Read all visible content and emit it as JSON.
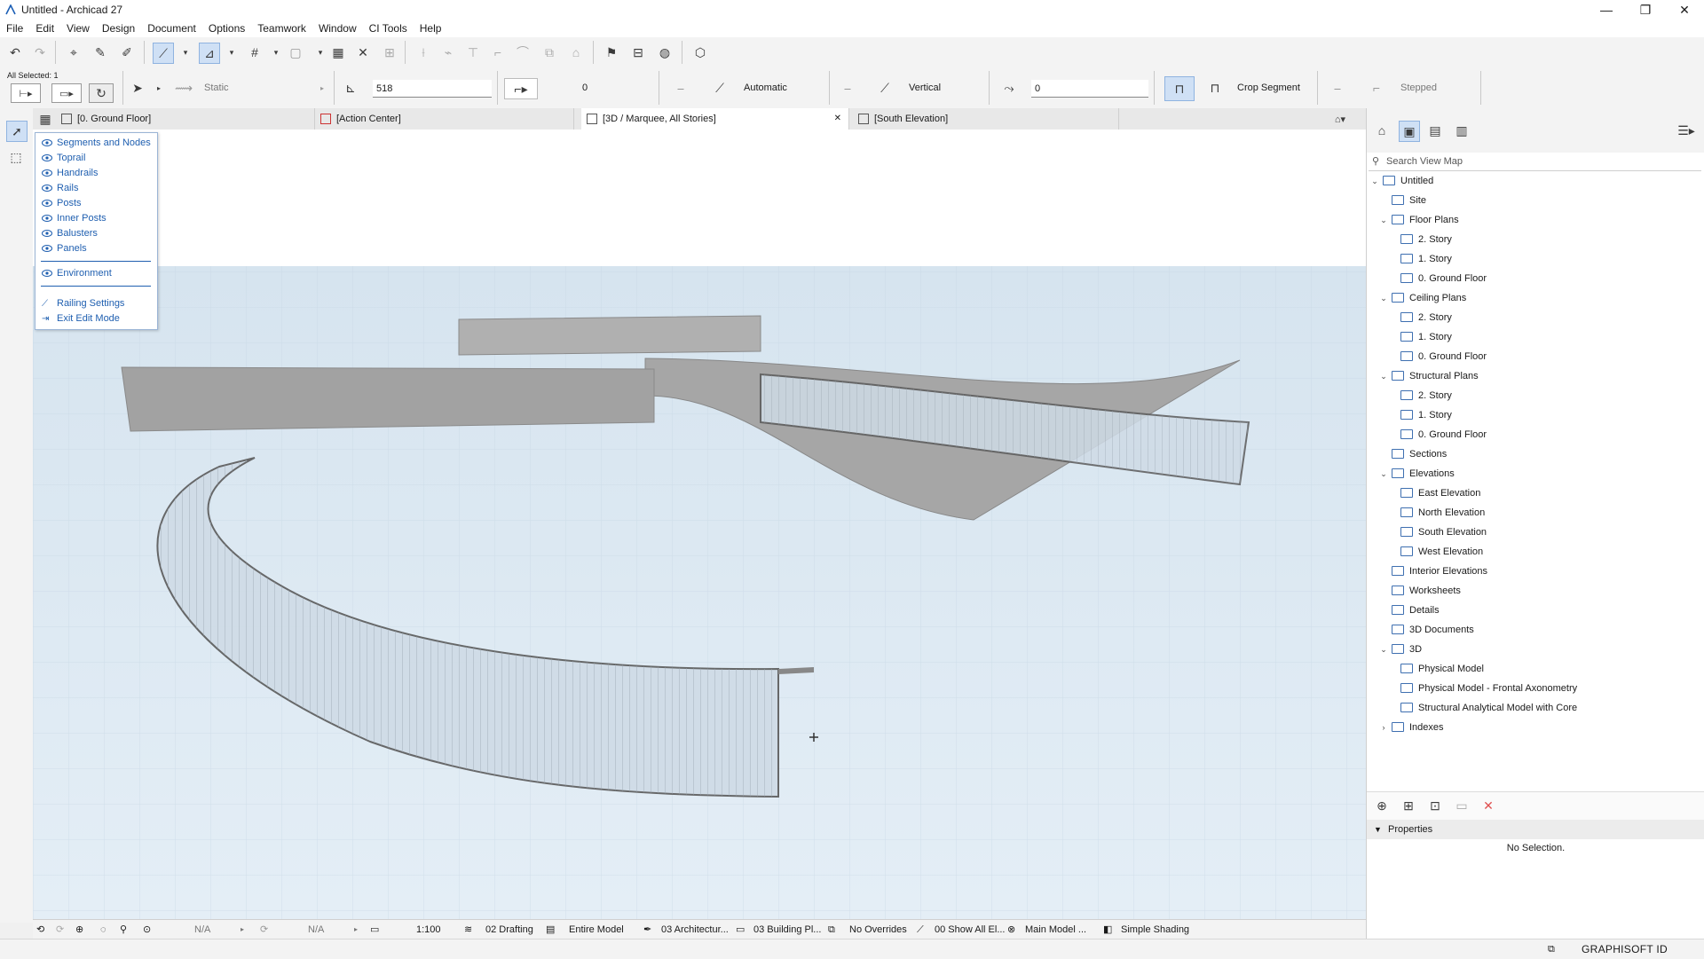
{
  "window": {
    "title": "Untitled - Archicad 27",
    "min": "—",
    "max": "❐",
    "close": "✕"
  },
  "menu": [
    "File",
    "Edit",
    "View",
    "Design",
    "Document",
    "Options",
    "Teamwork",
    "Window",
    "CI Tools",
    "Help"
  ],
  "infobox": {
    "all_selected": "All Selected: 1",
    "mode": "Static",
    "height_value": "518",
    "offset_value": "0",
    "automatic": "Automatic",
    "vertical": "Vertical",
    "slope_value": "0",
    "crop_segment": "Crop Segment",
    "stepped": "Stepped"
  },
  "tabs": [
    {
      "label": "[0. Ground Floor]",
      "active": false
    },
    {
      "label": "[Action Center]",
      "active": false
    },
    {
      "label": "[3D / Marquee, All Stories]",
      "active": true,
      "close": "✕"
    },
    {
      "label": "[South Elevation]",
      "active": false
    }
  ],
  "edit_popup": {
    "items": [
      "Segments and Nodes",
      "Toprail",
      "Handrails",
      "Rails",
      "Posts",
      "Inner Posts",
      "Balusters",
      "Panels"
    ],
    "environment": "Environment",
    "railing_settings": "Railing Settings",
    "exit_edit_mode": "Exit Edit Mode"
  },
  "statusbar": {
    "na1": "N/A",
    "na2": "N/A",
    "scale": "1:100",
    "layer_combo": "02 Drafting",
    "model_view": "Entire Model",
    "pen_set": "03 Architectur...",
    "building_plan": "03 Building Pl...",
    "overrides": "No Overrides",
    "renovation": "00 Show All El...",
    "main_model": "Main Model ...",
    "shading": "Simple Shading"
  },
  "brand": "GRAPHISOFT ID",
  "navigator": {
    "search_placeholder": "Search View Map",
    "tree": [
      {
        "label": "Untitled",
        "level": 0,
        "arrow": "down",
        "icon": "project"
      },
      {
        "label": "Site",
        "level": 1,
        "arrow": "",
        "icon": "plan"
      },
      {
        "label": "Floor Plans",
        "level": 1,
        "arrow": "down",
        "icon": "folder-plan"
      },
      {
        "label": "2. Story",
        "level": 2,
        "arrow": "",
        "icon": "plan"
      },
      {
        "label": "1. Story",
        "level": 2,
        "arrow": "",
        "icon": "plan"
      },
      {
        "label": "0. Ground Floor",
        "level": 2,
        "arrow": "",
        "icon": "plan"
      },
      {
        "label": "Ceiling Plans",
        "level": 1,
        "arrow": "down",
        "icon": "folder-plan"
      },
      {
        "label": "2. Story",
        "level": 2,
        "arrow": "",
        "icon": "plan"
      },
      {
        "label": "1. Story",
        "level": 2,
        "arrow": "",
        "icon": "plan"
      },
      {
        "label": "0. Ground Floor",
        "level": 2,
        "arrow": "",
        "icon": "plan"
      },
      {
        "label": "Structural Plans",
        "level": 1,
        "arrow": "down",
        "icon": "folder-plan"
      },
      {
        "label": "2. Story",
        "level": 2,
        "arrow": "",
        "icon": "plan"
      },
      {
        "label": "1. Story",
        "level": 2,
        "arrow": "",
        "icon": "plan"
      },
      {
        "label": "0. Ground Floor",
        "level": 2,
        "arrow": "",
        "icon": "plan"
      },
      {
        "label": "Sections",
        "level": 1,
        "arrow": "",
        "icon": "folder-section"
      },
      {
        "label": "Elevations",
        "level": 1,
        "arrow": "down",
        "icon": "folder-elev"
      },
      {
        "label": "East Elevation",
        "level": 2,
        "arrow": "",
        "icon": "elev"
      },
      {
        "label": "North Elevation",
        "level": 2,
        "arrow": "",
        "icon": "elev"
      },
      {
        "label": "South Elevation",
        "level": 2,
        "arrow": "",
        "icon": "elev"
      },
      {
        "label": "West Elevation",
        "level": 2,
        "arrow": "",
        "icon": "elev"
      },
      {
        "label": "Interior Elevations",
        "level": 1,
        "arrow": "",
        "icon": "folder-elev"
      },
      {
        "label": "Worksheets",
        "level": 1,
        "arrow": "",
        "icon": "folder-ws"
      },
      {
        "label": "Details",
        "level": 1,
        "arrow": "",
        "icon": "folder-detail"
      },
      {
        "label": "3D Documents",
        "level": 1,
        "arrow": "",
        "icon": "folder-3d"
      },
      {
        "label": "3D",
        "level": 1,
        "arrow": "down",
        "icon": "folder"
      },
      {
        "label": "Physical Model",
        "level": 2,
        "arrow": "",
        "icon": "3d"
      },
      {
        "label": "Physical Model - Frontal Axonometry",
        "level": 2,
        "arrow": "",
        "icon": "3d"
      },
      {
        "label": "Structural Analytical Model with Core",
        "level": 2,
        "arrow": "",
        "icon": "3d"
      },
      {
        "label": "Indexes",
        "level": 1,
        "arrow": "right",
        "icon": "folder"
      }
    ]
  },
  "properties": {
    "header": "Properties",
    "empty": "No Selection."
  }
}
